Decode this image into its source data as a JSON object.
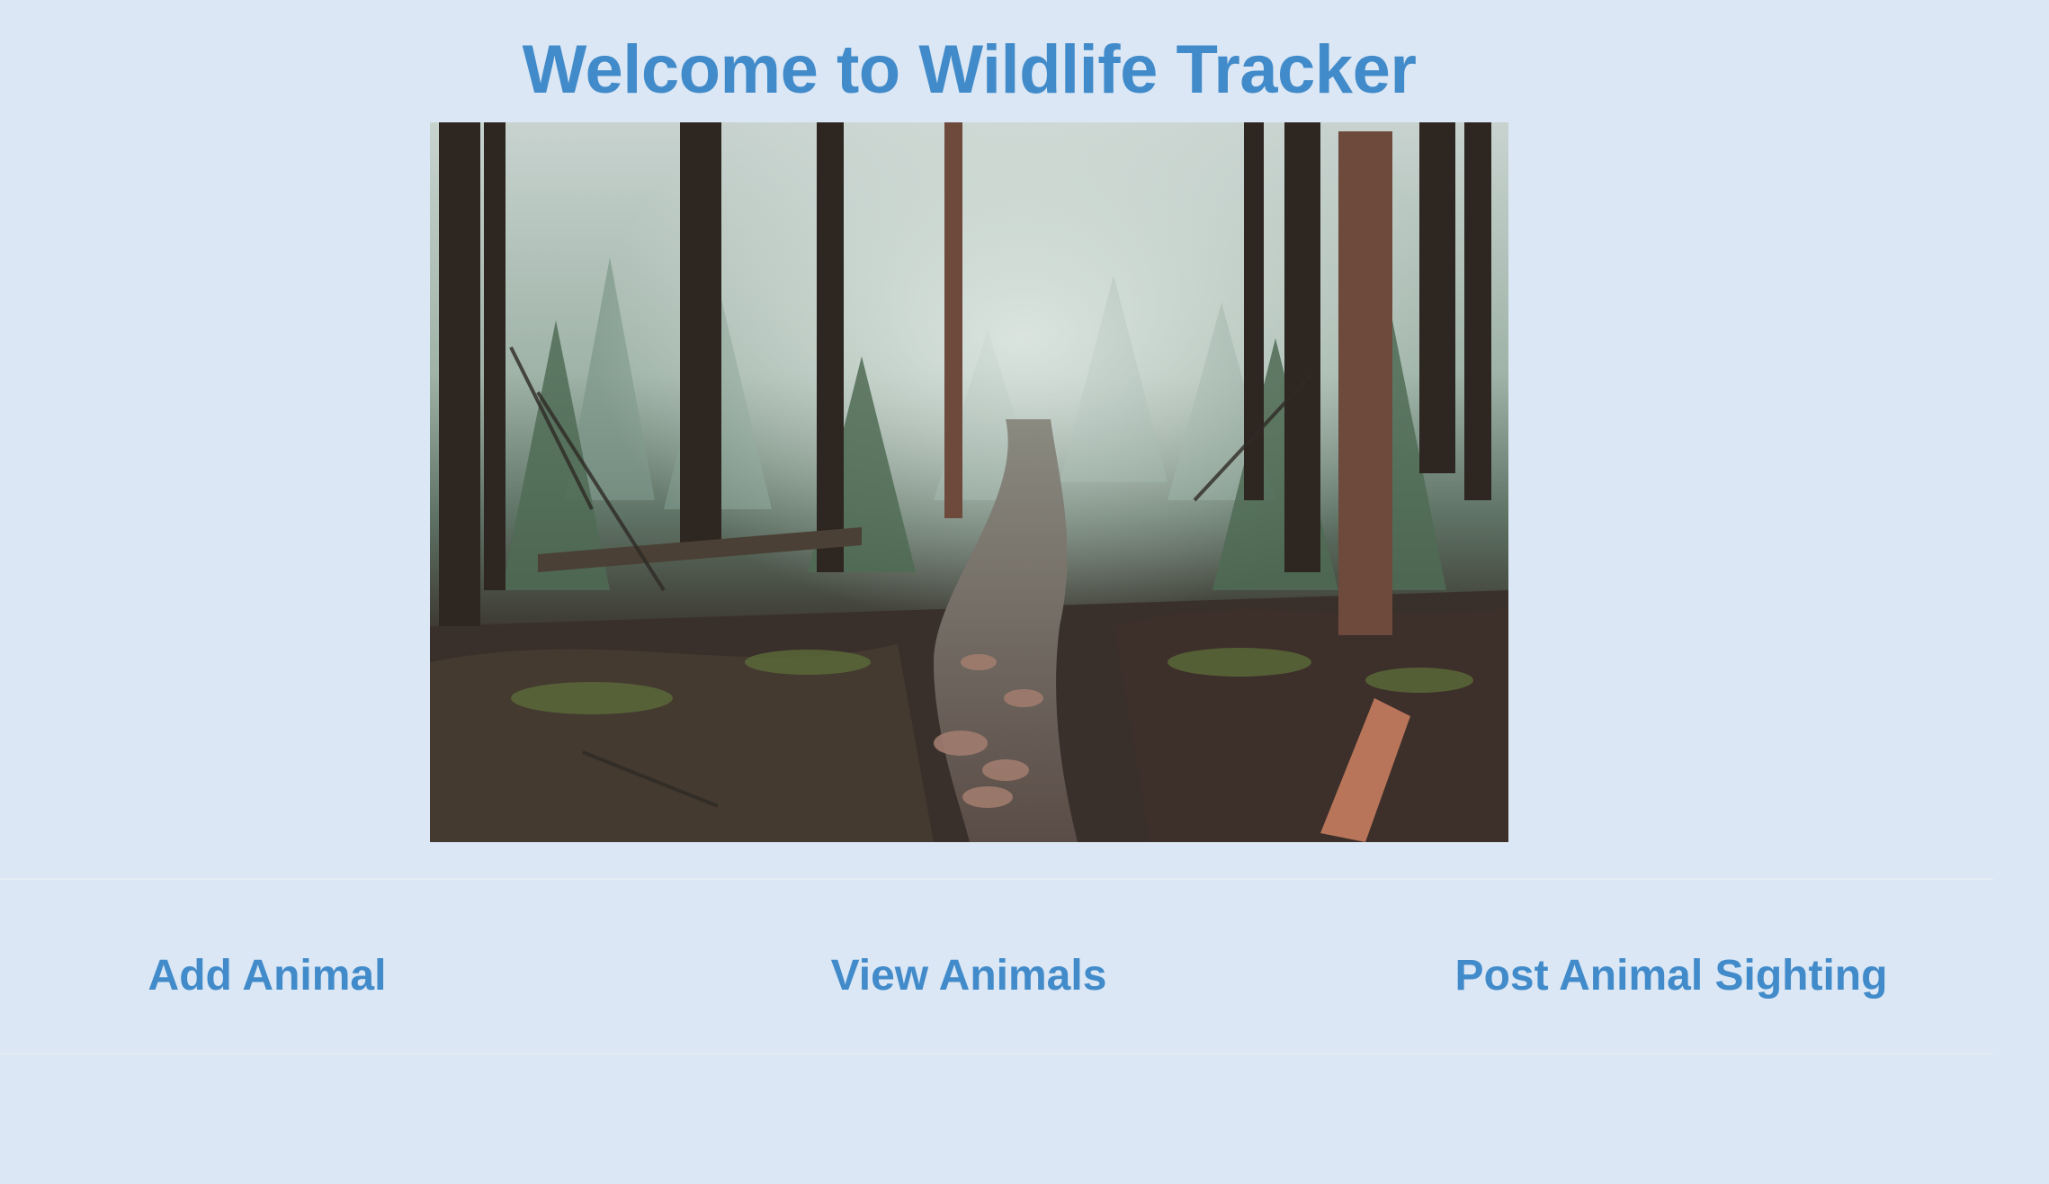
{
  "header": {
    "title": "Welcome to Wildlife Tracker"
  },
  "hero": {
    "icon": "forest-trail-photo"
  },
  "nav": {
    "items": [
      {
        "label": "Add Animal"
      },
      {
        "label": "View Animals"
      },
      {
        "label": "Post Animal Sighting"
      }
    ]
  },
  "colors": {
    "background": "#dbe7f4",
    "accent": "#428bca"
  }
}
